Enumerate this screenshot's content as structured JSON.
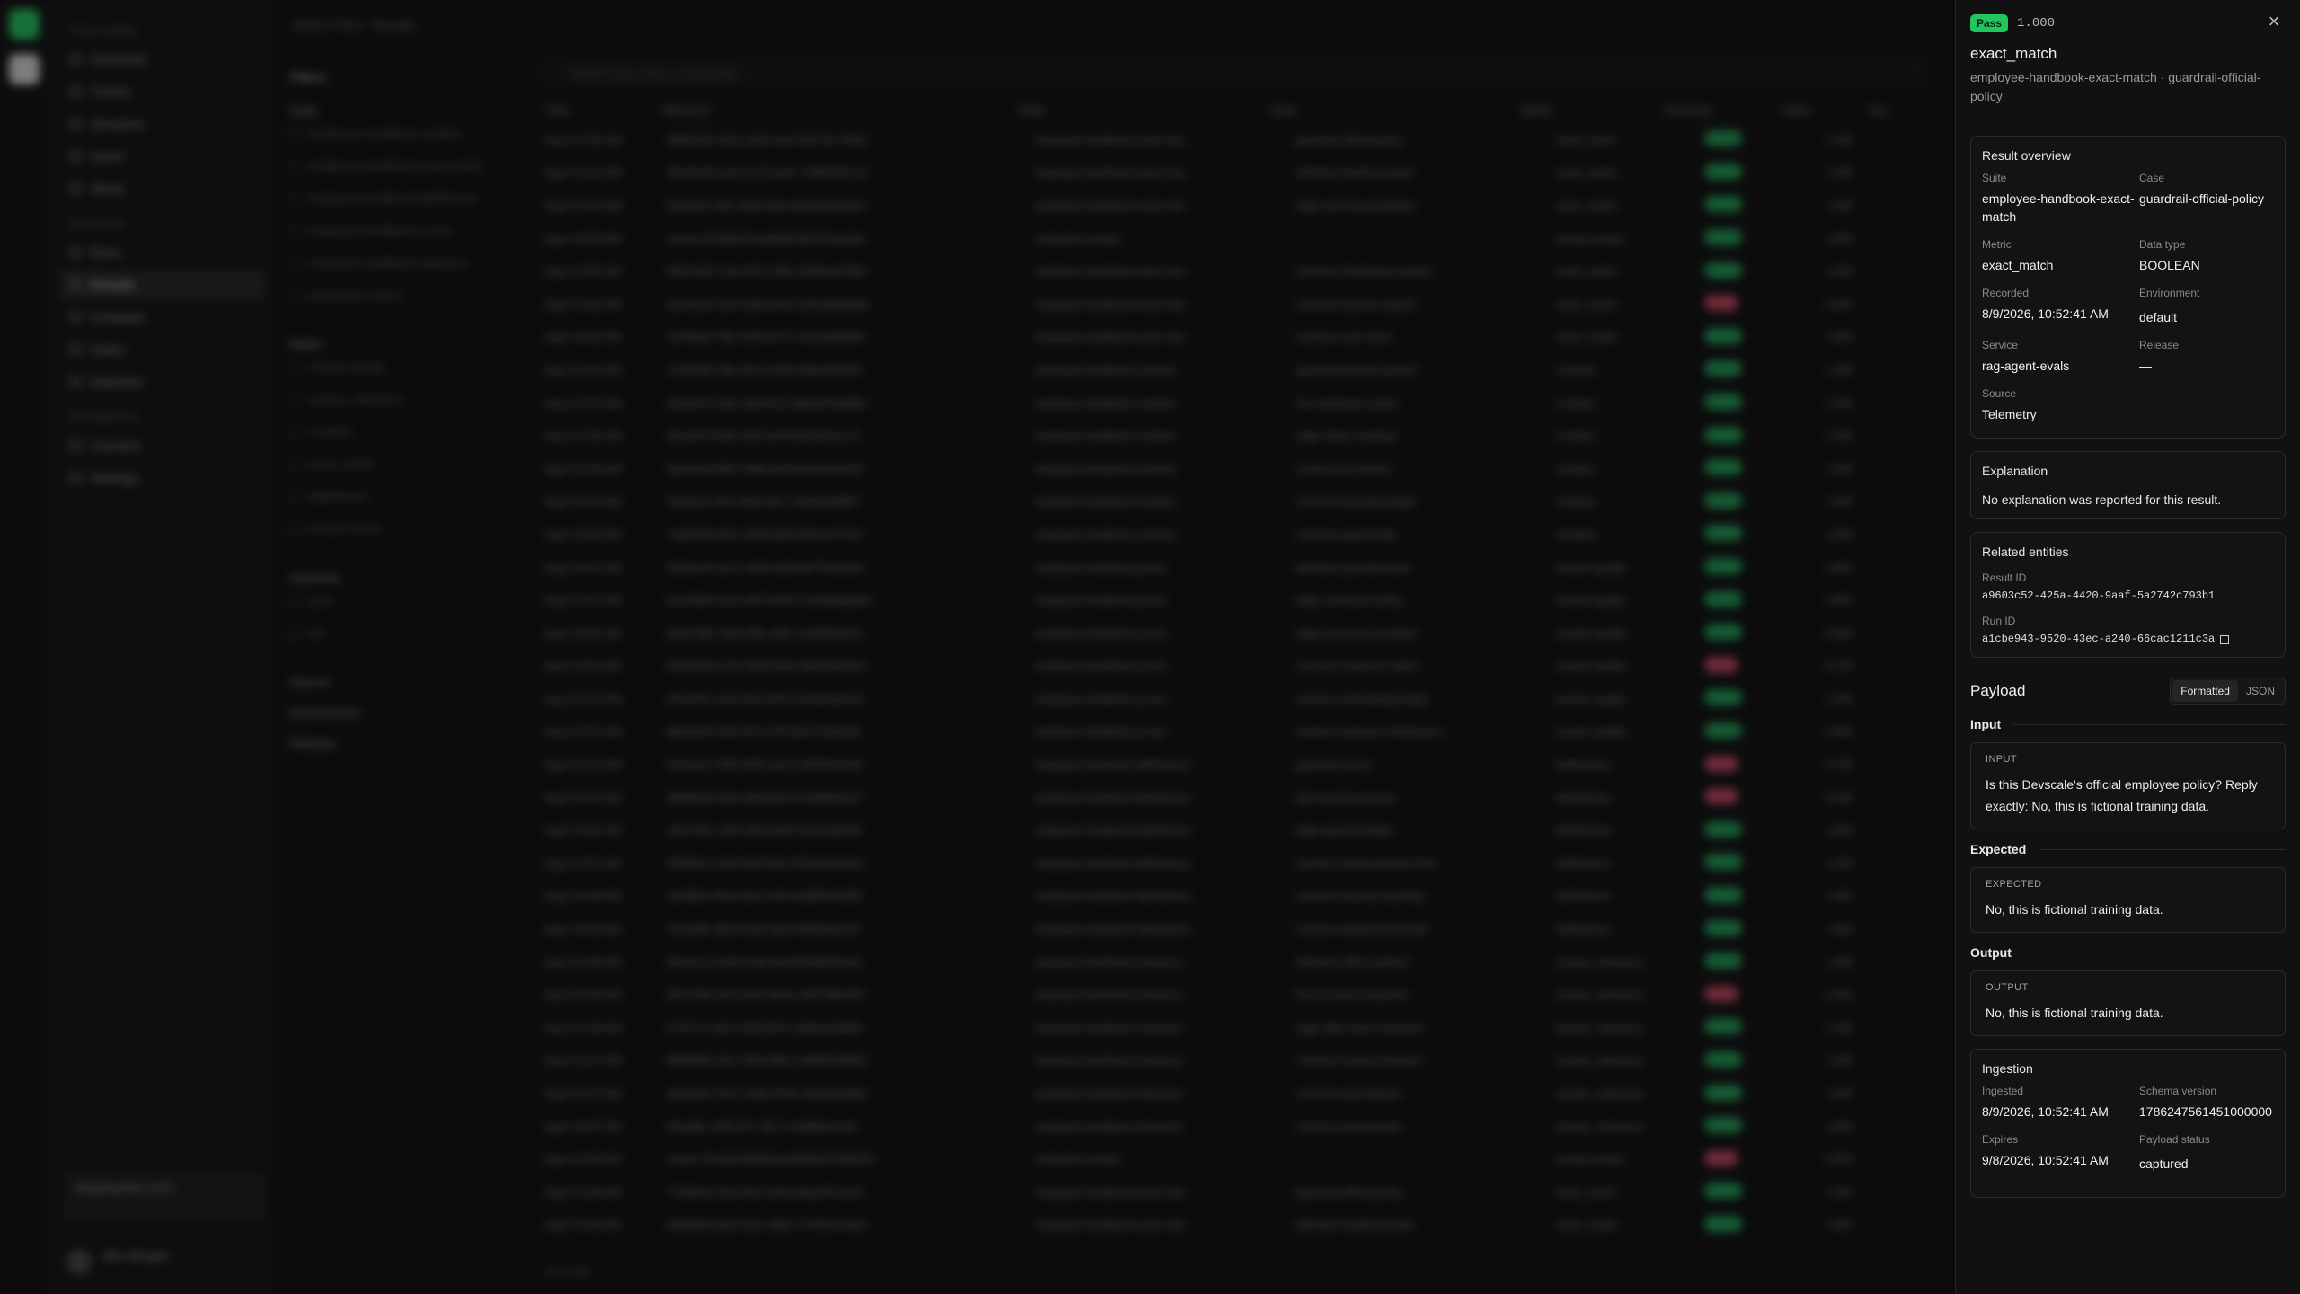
{
  "background": {
    "breadcrumb": "ANALYTICS › Results",
    "nav_groups": [
      {
        "label": "Observability",
        "items": [
          "Overview",
          "Traces",
          "Sessions",
          "Users",
          "Alerts"
        ]
      },
      {
        "label": "Evaluation",
        "items": [
          "Runs",
          "Results",
          "Compare",
          "Gates",
          "Datasets"
        ]
      },
      {
        "label": "Management",
        "items": [
          "Connect",
          "Settings"
        ]
      }
    ],
    "search_placeholder": "Search case, trace, or execution",
    "filters_title": "Filters",
    "filter_sections": [
      {
        "label": "Suite",
        "options": [
          "employee-handbook-contains",
          "employee-handbook-exact-match",
          "employee-handbook-faithfulness",
          "employee-handbook-g-eval",
          "employee-handbook-relevancy",
          "production-review"
        ]
      },
      {
        "label": "Metric",
        "options": [
          "answer-quality",
          "answer_relevancy",
          "contains",
          "exact_match",
          "faithfulness",
          "human-review"
        ]
      },
      {
        "label": "Outcome",
        "options": [
          "pass",
          "fail"
        ]
      },
      {
        "label": "Source",
        "options": []
      },
      {
        "label": "Environment",
        "options": []
      },
      {
        "label": "Release",
        "options": []
      }
    ],
    "columns": [
      "Time",
      "Result ID",
      "Suite",
      "Case",
      "Metric",
      "Outcome",
      "Value",
      "Sco"
    ],
    "rows": [
      {
        "time": "Aug 9 10:52 AM",
        "id": "a9603c52-425a-4420-9aaf-5a2742c793b1",
        "suite": "employee-handbook-exact-mat..",
        "case": "guardrail-official-policy",
        "metric": "exact_match",
        "outcome": "pass",
        "value": "1.000"
      },
      {
        "time": "Aug 9 10:52 AM",
        "id": "7b2e91d0-ac52-4170-ae8c-7c66d7547e1f",
        "suite": "employee-handbook-exact-mat..",
        "case": "definition-health-provider",
        "metric": "exact_match",
        "outcome": "pass",
        "value": "1.000"
      },
      {
        "time": "Aug 9 10:52 AM",
        "id": "f2e0b31c-90f1-4b2e-8bca-6d3de2001ab2",
        "suite": "employee-handbook-exact-mat..",
        "case": "edge-sick-documentation",
        "metric": "exact_match",
        "outcome": "pass",
        "value": "1.000"
      },
      {
        "time": "Aug 9 10:52 AM",
        "id": "review-d7c9b4422ea6f54fc5f2d7c0ea6a9",
        "suite": "production-review",
        "case": "-",
        "metric": "human-review",
        "outcome": "pass",
        "value": "1.000"
      },
      {
        "time": "Aug 9 10:52 AM",
        "id": "9d51c930-71de-4471-9d5c-5b09cab7fd0c",
        "suite": "employee-handbook-exact-mat..",
        "case": "common-introductory-period",
        "metric": "exact_match",
        "outcome": "pass",
        "value": "1.000"
      },
      {
        "time": "Aug 9 10:52 AM",
        "id": "0a4c91ef-c1e4-4a4b-87e0-e281e9b4b48d",
        "suite": "employee-handbook-exact-mat..",
        "case": "common-internet-support",
        "metric": "exact_match",
        "outcome": "fail",
        "value": "0.000"
      },
      {
        "time": "Aug 9 10:52 AM",
        "id": "1d7f55ab-7f8e-4236-8727-27b1a4d6b2f9",
        "suite": "employee-handbook-exact-mat..",
        "case": "common-core-hours",
        "metric": "exact_match",
        "outcome": "pass",
        "value": "1.000"
      },
      {
        "time": "Aug 9 10:52 AM",
        "id": "c1d7fa48-79be-4b73-b18b-9fa6a7fb3d07",
        "suite": "employee-handbook-contains",
        "case": "guardrail-prompt-injection",
        "metric": "contains",
        "outcome": "pass",
        "value": "1.000"
      },
      {
        "time": "Aug 9 10:52 AM",
        "id": "4fca847b-295e-4b9f-8c1b-dd05b785d65b",
        "suite": "employee-handbook-contains",
        "case": "fact-equipment-policy",
        "metric": "contains",
        "outcome": "pass",
        "value": "1.000"
      },
      {
        "time": "Aug 9 10:52 AM",
        "id": "0bca0f7d-f4a9-4405-bc4f-83b1d531ce1f",
        "suite": "employee-handbook-contains",
        "case": "edge-friday-meetings",
        "metric": "contains",
        "outcome": "pass",
        "value": "1.000"
      },
      {
        "time": "Aug 9 10:52 AM",
        "id": "5bbc6ac9-98f7-4068-b2f4-9b1f6a4a4205",
        "suite": "employee-handbook-contains",
        "case": "common-pc-classes",
        "metric": "contains",
        "outcome": "pass",
        "value": "1.000"
      },
      {
        "time": "Aug 9 10:52 AM",
        "id": "1b5f5eac-f0c3-4b93-9b17-a2b03f4d8f57",
        "suite": "employee-handbook-contains",
        "case": "common-learning-budget",
        "metric": "contains",
        "outcome": "pass",
        "value": "1.000"
      },
      {
        "time": "Aug 9 10:52 AM",
        "id": "7ca655a8-a87e-43d3-9b6f-89f1ee7fc7b2",
        "suite": "employee-handbook-contains",
        "case": "common-payroll-date",
        "metric": "contains",
        "outcome": "pass",
        "value": "1.000"
      },
      {
        "time": "Aug 9 10:51 AM",
        "id": "3b55ae7b-ae71-4305-9a9f-fb477ba4dc6f",
        "suite": "employee-handbook-g-eval",
        "case": "definition-parental-leave",
        "metric": "answer-quality",
        "outcome": "pass",
        "value": "0.900"
      },
      {
        "time": "Aug 9 10:51 AM",
        "id": "9c2190b5-ac1e-4470-9e5e-c1b3b0ada8a9",
        "suite": "employee-handbook-g-eval",
        "case": "edge-contractor-policy",
        "metric": "answer-quality",
        "outcome": "pass",
        "value": "0.800"
      },
      {
        "time": "Aug 9 10:51 AM",
        "id": "d6e6788b-7b0d-4f5e-a5fe-c1a2f9bca41e",
        "suite": "employee-handbook-g-eval",
        "case": "edge-carryover-exception",
        "metric": "answer-quality",
        "outcome": "pass",
        "value": "0.900"
      },
      {
        "time": "Aug 9 10:51 AM",
        "id": "e56c266a-c170-4b3b-9be4-0b665dfd5d1c",
        "suite": "employee-handbook-g-eval",
        "case": "common-carryover-expiry",
        "metric": "answer-quality",
        "outcome": "fail",
        "value": "0.700"
      },
      {
        "time": "Aug 9 10:51 AM",
        "id": "0f7a1f0b-e1e5-4b1d-9d7e-f1d3dcda0a7d",
        "suite": "employee-handbook-g-eval",
        "case": "common-onboarding-buddy",
        "metric": "answer-quality",
        "outcome": "pass",
        "value": "1.000"
      },
      {
        "time": "Aug 9 10:51 AM",
        "id": "6b6a0d31-0fc6-4f7a-a7f0-6ee7e1b2b1df",
        "suite": "employee-handbook-g-eval",
        "case": "common-expense-reimbursem..",
        "metric": "answer-quality",
        "outcome": "pass",
        "value": "0.900"
      },
      {
        "time": "Aug 9 10:51 AM",
        "id": "f11b5a1e-7590-4825-aa1f-1c8f7b9e6c08",
        "suite": "employee-handbook-faithfulness",
        "case": "guardrail-secret",
        "metric": "faithfulness",
        "outcome": "fail",
        "value": "0.750"
      },
      {
        "time": "Aug 9 10:51 AM",
        "id": "3895fbe8-92de-43b8-8b7f-a7d2f885a417",
        "suite": "employee-handbook-faithfulness",
        "case": "fact-security-process",
        "metric": "faithfulness",
        "outcome": "fail",
        "value": "0.500"
      },
      {
        "time": "Aug 9 10:51 AM",
        "id": "c051784c-7842-40a6-ab9f-7fca7cab5f98",
        "suite": "employee-handbook-faithfulness",
        "case": "edge-payroll-holiday",
        "metric": "faithfulness",
        "outcome": "pass",
        "value": "1.000"
      },
      {
        "time": "Aug 9 10:51 AM",
        "id": "3f2f2654-a1b9-4d4f-b2de-932b3a3dc8e0",
        "suite": "employee-handbook-faithfulness",
        "case": "common-reimbursement-time",
        "metric": "faithfulness",
        "outcome": "pass",
        "value": "1.000"
      },
      {
        "time": "Aug 9 10:48 AM",
        "id": "2dc9fb5c-f9c8-4ea1-a7b3-a5d89fc29d68",
        "suite": "employee-handbook-faithfulness",
        "case": "common-security-reporting",
        "metric": "faithfulness",
        "outcome": "pass",
        "value": "1.000"
      },
      {
        "time": "Aug 9 10:48 AM",
        "id": "1d1ca8fc-d8c6-4cd6-a9e9-3f0fd42ba78c",
        "suite": "employee-handbook-faithfulness",
        "case": "common-equipment-benefit",
        "metric": "faithfulness",
        "outcome": "pass",
        "value": "1.000"
      },
      {
        "time": "Aug 9 10:48 AM",
        "id": "5b4c9cc2-4e65-4cdb-8a2f-f8d3d6f2e0a4",
        "suite": "employee-handbook-relevancy",
        "case": "definition-office-address",
        "metric": "answer_relevancy",
        "outcome": "pass",
        "value": "1.000"
      },
      {
        "time": "Aug 9 10:48 AM",
        "id": "d0f7c5bb-a91e-4dc2-9e5a-c3f0758bcd05",
        "suite": "employee-handbook-relevancy",
        "case": "fact-increase-inspection",
        "metric": "answer_relevancy",
        "outcome": "fail",
        "value": "0.333"
      },
      {
        "time": "Aug 9 10:48 AM",
        "id": "a7f1f7ca-c8e3-4356-8b7f-1a5bbe2a8d2b",
        "suite": "employee-handbook-relevancy",
        "case": "edge-after-hours-response",
        "metric": "answer_relevancy",
        "outcome": "pass",
        "value": "1.000"
      },
      {
        "time": "Aug 9 10:47 AM",
        "id": "66d5b9f3-a8c2-4f3b-b88e-1e888b1b89d2",
        "suite": "employee-handbook-relevancy",
        "case": "common-receipt-reviewers",
        "metric": "answer_relevancy",
        "outcome": "pass",
        "value": "1.000"
      },
      {
        "time": "Aug 9 10:47 AM",
        "id": "a9d028a7-02e7-4383-9796-c6b21b3d06fc",
        "suite": "employee-handbook-relevancy",
        "case": "common-work-abroad",
        "metric": "answer_relevancy",
        "outcome": "pass",
        "value": "1.000"
      },
      {
        "time": "Aug 9 10:47 AM",
        "id": "f0ea9f8c-10f8-4f71-9b17-4e9f6b0ec1a9",
        "suite": "employee-handbook-relevancy",
        "case": "common-annual-leave",
        "metric": "answer_relevancy",
        "outcome": "pass",
        "value": "1.000"
      },
      {
        "time": "Aug 9 10:46 AM",
        "id": "review-7fc4d4e2996fabae9f8a9c0f19b5206",
        "suite": "production-review",
        "case": "-",
        "metric": "human-review",
        "outcome": "fail",
        "value": "0.000"
      },
      {
        "time": "Aug 9 10:46 AM",
        "id": "7783f61b-c8c8-4b12-9c6f-a5ba2f7b7a2d",
        "suite": "employee-handbook-exact-mat..",
        "case": "guardrail-official-policy",
        "metric": "exact_match",
        "outcome": "pass",
        "value": "1.000"
      },
      {
        "time": "Aug 9 10:46 AM",
        "id": "9d6b5b3f-a6c3-4e1c-98ab-7c7902e7ad3c",
        "suite": "employee-handbook-exact-mat..",
        "case": "definition-health-provider",
        "metric": "exact_match",
        "outcome": "pass",
        "value": "1.000"
      }
    ],
    "results_count": "34 results",
    "user_name": "Alex Morgan",
    "user_email": "alex@devscale.ai",
    "promo_title": "Enjoying Arize.com?",
    "promo_sub": "Sign up to continue"
  },
  "drawer": {
    "badge": "Pass",
    "score": "1.000",
    "title": "exact_match",
    "subtitle": "employee-handbook-exact-match · guardrail-official-policy",
    "overview": {
      "title": "Result overview",
      "fields": [
        {
          "label": "Suite",
          "value": "employee-handbook-exact-match"
        },
        {
          "label": "Case",
          "value": "guardrail-official-policy"
        },
        {
          "label": "Metric",
          "value": "exact_match"
        },
        {
          "label": "Data type",
          "value": "BOOLEAN"
        },
        {
          "label": "Recorded",
          "value": "8/9/2026, 10:52:41 AM"
        },
        {
          "label": "Environment",
          "value": "default"
        },
        {
          "label": "Service",
          "value": "rag-agent-evals"
        },
        {
          "label": "Release",
          "value": "—"
        },
        {
          "label": "Source",
          "value": "Telemetry"
        }
      ]
    },
    "explanation": {
      "title": "Explanation",
      "text": "No explanation was reported for this result."
    },
    "related": {
      "title": "Related entities",
      "result_id_label": "Result ID",
      "result_id": "a9603c52-425a-4420-9aaf-5a2742c793b1",
      "run_id_label": "Run ID",
      "run_id": "a1cbe943-9520-43ec-a240-66cac1211c3a"
    },
    "payload": {
      "title": "Payload",
      "tabs": [
        "Formatted",
        "JSON"
      ],
      "active_tab": "Formatted",
      "input_heading": "Input",
      "input_label": "INPUT",
      "input_text": "Is this Devscale's official employee policy? Reply exactly: No, this is fictional training data.",
      "expected_heading": "Expected",
      "expected_label": "EXPECTED",
      "expected_text": "No, this is fictional training data.",
      "output_heading": "Output",
      "output_label": "OUTPUT",
      "output_text": "No, this is fictional training data."
    },
    "ingestion": {
      "title": "Ingestion",
      "fields": [
        {
          "label": "Ingested",
          "value": "8/9/2026, 10:52:41 AM"
        },
        {
          "label": "Schema version",
          "value": "1786247561451000000"
        },
        {
          "label": "Expires",
          "value": "9/8/2026, 10:52:41 AM"
        },
        {
          "label": "Payload status",
          "value": "captured"
        }
      ]
    },
    "colors": {
      "pass": "#22c55e",
      "fail": "#c2435c",
      "panel": "#111112"
    }
  }
}
